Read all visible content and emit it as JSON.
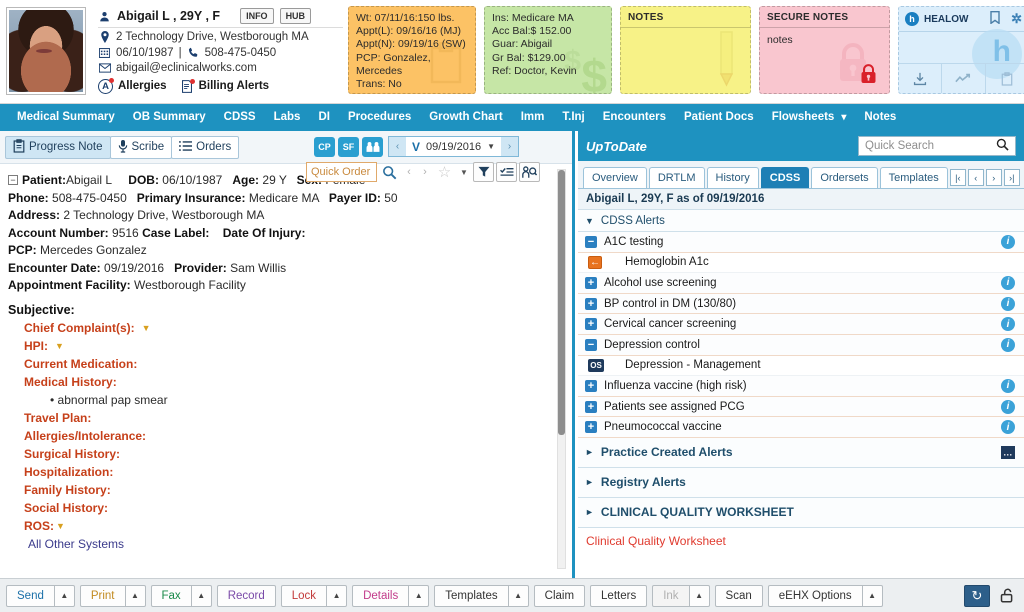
{
  "patient": {
    "name": "Abigail L",
    "age": "29Y",
    "sex": "F",
    "info_btn": "INFO",
    "hub_btn": "HUB",
    "address": "2 Technology Drive, Westborough MA",
    "dob": "06/10/1987",
    "phone": "508-475-0450",
    "email": "abigail@eclinicalworks.com",
    "allergies_label": "Allergies",
    "billing_label": "Billing Alerts"
  },
  "cards": {
    "orange": {
      "lines": [
        "Wt: 07/11/16:150 lbs.",
        "Appt(L): 09/16/16 (MJ)",
        "Appt(N): 09/19/16 (SW)",
        "PCP: Gonzalez, Mercedes",
        "Trans: No"
      ]
    },
    "green": {
      "lines": [
        "Ins: Medicare MA",
        "Acc Bal:$ 152.00",
        "Guar: Abigail",
        "Gr Bal: $129.00",
        "Ref: Doctor, Kevin"
      ]
    },
    "notes": {
      "title": "NOTES",
      "body": ""
    },
    "secure_notes": {
      "title": "SECURE NOTES",
      "body": "notes"
    },
    "healow": {
      "title": "HEALOW"
    }
  },
  "nav": {
    "items": [
      "Medical Summary",
      "OB Summary",
      "CDSS",
      "Labs",
      "DI",
      "Procedures",
      "Growth Chart",
      "Imm",
      "T.Inj",
      "Encounters",
      "Patient Docs",
      "Flowsheets",
      "Notes"
    ]
  },
  "left_toolbar": {
    "progress_note": "Progress Note",
    "scribe": "Scribe",
    "orders": "Orders",
    "cp_btn": "CP",
    "sf_btn": "SF",
    "date_prefix": "V",
    "date": "09/19/2016",
    "quick_order_placeholder": "Quick Order"
  },
  "demographics": {
    "patient_label": "Patient:",
    "patient_value": "Abigail L",
    "dob_label": "DOB:",
    "dob_value": "06/10/1987",
    "age_label": "Age:",
    "age_value": "29 Y",
    "sex_label": "Sex:",
    "sex_value": "Female",
    "phone_label": "Phone:",
    "phone_value": "508-475-0450",
    "insurance_label": "Primary Insurance:",
    "insurance_value": "Medicare MA",
    "payer_label": "Payer ID:",
    "payer_value": "50",
    "address_label": "Address:",
    "address_value": "2 Technology Drive, Westborough MA",
    "account_label": "Account Number:",
    "account_value": "9516",
    "case_label": "Case Label:",
    "injury_label": "Date Of Injury:",
    "pcp_label": "PCP:",
    "pcp_value": "Mercedes Gonzalez",
    "encounter_label": "Encounter Date:",
    "encounter_value": "09/19/2016",
    "provider_label": "Provider:",
    "provider_value": "Sam Willis",
    "facility_label": "Appointment Facility:",
    "facility_value": "Westborough Facility"
  },
  "subjective": {
    "title": "Subjective:",
    "items": [
      {
        "label": "Chief Complaint(s):",
        "caret": true
      },
      {
        "label": "HPI:",
        "caret": true
      },
      {
        "label": "Current Medication:",
        "caret": false
      },
      {
        "label": "Medical History:",
        "caret": false
      }
    ],
    "medical_history_entry": "abnormal pap smear",
    "items2": [
      {
        "label": "Travel Plan:",
        "caret": false
      },
      {
        "label": "Allergies/Intolerance:",
        "caret": false
      },
      {
        "label": "Surgical History:",
        "caret": false
      },
      {
        "label": "Hospitalization:",
        "caret": false
      },
      {
        "label": "Family History:",
        "caret": false
      },
      {
        "label": "Social History:",
        "caret": false
      },
      {
        "label": "ROS:",
        "caret": true
      }
    ],
    "ros_entry": "All Other Systems"
  },
  "right_panel": {
    "title": "UpToDate",
    "search_placeholder": "Quick Search",
    "tabs": [
      {
        "label": "Overview",
        "active": false
      },
      {
        "label": "DRTLM",
        "active": false
      },
      {
        "label": "History",
        "active": false
      },
      {
        "label": "CDSS",
        "active": true
      },
      {
        "label": "Ordersets",
        "active": false
      },
      {
        "label": "Templates",
        "active": false
      }
    ],
    "as_of": "Abigail L, 29Y, F as of 09/19/2016",
    "cdss_alerts_header": "CDSS Alerts",
    "alerts": [
      {
        "label": "A1C testing",
        "icon": "minus",
        "info": true
      },
      {
        "label": "Hemoglobin A1c",
        "icon": "arrow",
        "info": false,
        "child": true
      },
      {
        "label": "Alcohol use screening",
        "icon": "plus",
        "info": true
      },
      {
        "label": "BP control in DM (130/80)",
        "icon": "plus",
        "info": true
      },
      {
        "label": "Cervical cancer screening",
        "icon": "plus",
        "info": true
      },
      {
        "label": "Depression control",
        "icon": "minus",
        "info": true
      },
      {
        "label": "Depression - Management",
        "icon": "os",
        "info": false,
        "child": true
      },
      {
        "label": "Influenza vaccine (high risk)",
        "icon": "plus",
        "info": true
      },
      {
        "label": "Patients see assigned PCG",
        "icon": "plus",
        "info": true
      },
      {
        "label": "Pneumococcal vaccine",
        "icon": "plus",
        "info": true
      }
    ],
    "practice_alerts": "Practice Created Alerts",
    "registry_alerts": "Registry Alerts",
    "cqw_header": "CLINICAL QUALITY WORKSHEET",
    "cqw_link": "Clinical Quality Worksheet"
  },
  "bottom_bar": {
    "buttons": [
      {
        "label": "Send",
        "caret": true,
        "disabled": false,
        "accent": "accent-s"
      },
      {
        "label": "Print",
        "caret": true,
        "disabled": false,
        "accent": "accent-p"
      },
      {
        "label": "Fax",
        "caret": true,
        "disabled": false,
        "accent": "accent-f"
      },
      {
        "label": "Record",
        "caret": false,
        "disabled": false,
        "accent": "accent-r"
      },
      {
        "label": "Lock",
        "caret": true,
        "disabled": false,
        "accent": "accent-l"
      },
      {
        "label": "Details",
        "caret": true,
        "disabled": false,
        "accent": "accent-d"
      },
      {
        "label": "Templates",
        "caret": true,
        "disabled": false,
        "accent": ""
      },
      {
        "label": "Claim",
        "caret": false,
        "disabled": false,
        "accent": ""
      },
      {
        "label": "Letters",
        "caret": false,
        "disabled": false,
        "accent": ""
      },
      {
        "label": "Ink",
        "caret": true,
        "disabled": true,
        "accent": ""
      },
      {
        "label": "Scan",
        "caret": false,
        "disabled": false,
        "accent": ""
      },
      {
        "label": "eEHX Options",
        "caret": true,
        "disabled": false,
        "accent": ""
      }
    ]
  }
}
